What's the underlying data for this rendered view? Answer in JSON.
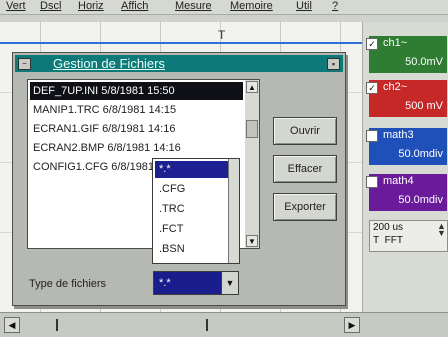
{
  "menu": [
    "Vert",
    "Dscl",
    "Horiz",
    "Affich",
    "Mesure",
    "Memoire",
    "Util",
    "?"
  ],
  "top_marker": "T",
  "dialog": {
    "title": "Gestion de Fichiers",
    "files": [
      "DEF_7UP.INI  5/8/1981 15:50",
      "MANIP1.TRC   6/8/1981 14:15",
      "ECRAN1.GIF   6/8/1981 14:16",
      "ECRAN2.BMP   6/8/1981 14:16",
      "CONFIG1.CFG  6/8/1981 14:16"
    ],
    "buttons": {
      "open": "Ouvrir",
      "delete": "Effacer",
      "export": "Exporter"
    },
    "type_label": "Type de fichiers",
    "type_value": "*.*",
    "type_options": [
      "*.*",
      ".CFG",
      ".TRC",
      ".FCT",
      ".BSN"
    ]
  },
  "channels": [
    {
      "name": "ch1~",
      "value": "50.0mV",
      "color": "#2e7d32",
      "checked": true
    },
    {
      "name": "ch2~",
      "value": "500 mV",
      "color": "#c62828",
      "checked": true
    },
    {
      "name": "math3",
      "value": "50.0mdiv",
      "color": "#1f4fb8",
      "checked": false
    },
    {
      "name": "math4",
      "value": "50.0mdiv",
      "color": "#6a1b9a",
      "checked": false
    }
  ],
  "timebase": {
    "value": "200 us",
    "mode": "FFT",
    "trigger": "T"
  }
}
